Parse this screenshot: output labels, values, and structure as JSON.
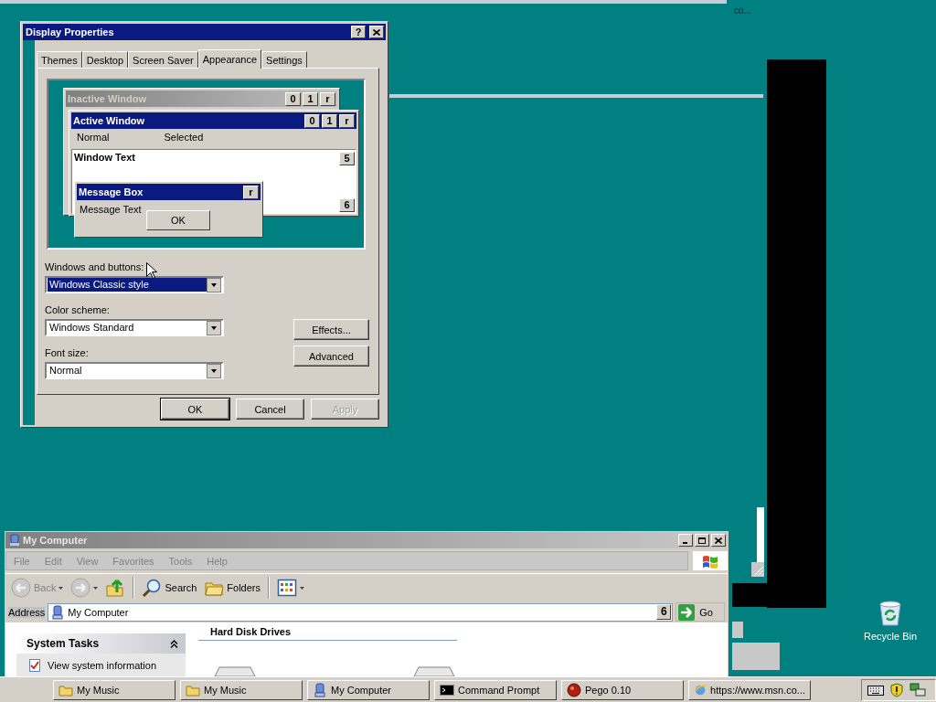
{
  "desktop": {
    "stray_text": "co...",
    "icons": [
      {
        "label": "Recycle Bin"
      }
    ]
  },
  "display_properties": {
    "title": "Display Properties",
    "help_button": "?",
    "tabs": [
      {
        "label": "Themes",
        "selected": false
      },
      {
        "label": "Desktop",
        "selected": false
      },
      {
        "label": "Screen Saver",
        "selected": false
      },
      {
        "label": "Appearance",
        "selected": true
      },
      {
        "label": "Settings",
        "selected": false
      }
    ],
    "preview": {
      "inactive_title": "Inactive Window",
      "inactive_buttons": [
        "0",
        "1",
        "r"
      ],
      "active_title": "Active Window",
      "active_buttons": [
        "0",
        "1",
        "r"
      ],
      "menu": [
        "Normal",
        "Selected"
      ],
      "window_text": "Window Text",
      "scroll_buttons": [
        "5",
        "6"
      ],
      "message_title": "Message Box",
      "message_button": "r",
      "message_text": "Message Text",
      "message_ok": "OK"
    },
    "fields": [
      {
        "label": "Windows and buttons:",
        "value": "Windows Classic style",
        "selected": true
      },
      {
        "label": "Color scheme:",
        "value": "Windows Standard",
        "selected": false
      },
      {
        "label": "Font size:",
        "value": "Normal",
        "selected": false
      }
    ],
    "side_buttons": [
      "Effects...",
      "Advanced"
    ],
    "buttons": [
      {
        "label": "OK",
        "disabled": false
      },
      {
        "label": "Cancel",
        "disabled": false
      },
      {
        "label": "Apply",
        "disabled": true
      }
    ]
  },
  "my_computer": {
    "title": "My Computer",
    "menu": [
      {
        "label": "File",
        "disabled": true
      },
      {
        "label": "Edit",
        "disabled": true
      },
      {
        "label": "View",
        "disabled": true
      },
      {
        "label": "Favorites",
        "disabled": true
      },
      {
        "label": "Tools",
        "disabled": true
      },
      {
        "label": "Help",
        "disabled": true
      }
    ],
    "toolbar": [
      {
        "kind": "back",
        "label": "Back",
        "disabled": true
      },
      {
        "kind": "forward",
        "disabled": true
      },
      {
        "kind": "up",
        "disabled": false
      },
      {
        "kind": "search",
        "label": "Search",
        "disabled": false
      },
      {
        "kind": "folders",
        "label": "Folders",
        "disabled": false
      },
      {
        "kind": "views",
        "disabled": false
      }
    ],
    "address_label": "Address",
    "address_value": "My Computer",
    "address_badge": "6",
    "go": "Go",
    "tasks_title": "System Tasks",
    "tasks": [
      "View system information"
    ],
    "section": "Hard Disk Drives"
  },
  "taskbar": {
    "items": [
      {
        "kind": "folder",
        "label": "My Music"
      },
      {
        "kind": "folder",
        "label": "My Music"
      },
      {
        "kind": "computer",
        "label": "My Computer"
      },
      {
        "kind": "console",
        "label": "Command Prompt"
      },
      {
        "kind": "game",
        "label": "Pego 0.10"
      },
      {
        "kind": "browser",
        "label": "https://www.msn.co..."
      }
    ]
  }
}
